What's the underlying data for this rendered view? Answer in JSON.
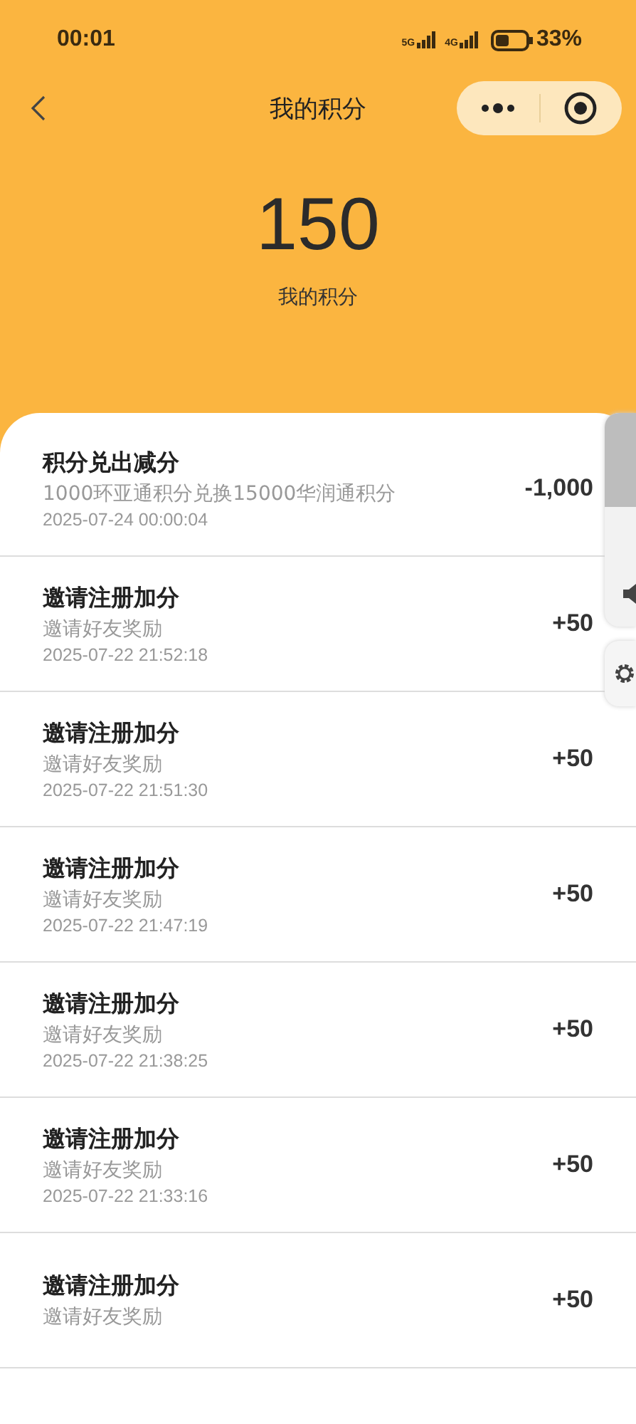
{
  "status_bar": {
    "time": "00:01",
    "network_1": "5G",
    "network_2": "4G",
    "battery": "33%"
  },
  "nav": {
    "title": "我的积分"
  },
  "summary": {
    "points": "150",
    "label": "我的积分"
  },
  "records": [
    {
      "title": "积分兑出减分",
      "desc": "1000环亚通积分兑换15000华润通积分",
      "time": "2025-07-24 00:00:04",
      "amount": "-1,000"
    },
    {
      "title": "邀请注册加分",
      "desc": "邀请好友奖励",
      "time": "2025-07-22 21:52:18",
      "amount": "+50"
    },
    {
      "title": "邀请注册加分",
      "desc": "邀请好友奖励",
      "time": "2025-07-22 21:51:30",
      "amount": "+50"
    },
    {
      "title": "邀请注册加分",
      "desc": "邀请好友奖励",
      "time": "2025-07-22 21:47:19",
      "amount": "+50"
    },
    {
      "title": "邀请注册加分",
      "desc": "邀请好友奖励",
      "time": "2025-07-22 21:38:25",
      "amount": "+50"
    },
    {
      "title": "邀请注册加分",
      "desc": "邀请好友奖励",
      "time": "2025-07-22 21:33:16",
      "amount": "+50"
    },
    {
      "title": "邀请注册加分",
      "desc": "邀请好友奖励",
      "amount": "+50"
    }
  ]
}
